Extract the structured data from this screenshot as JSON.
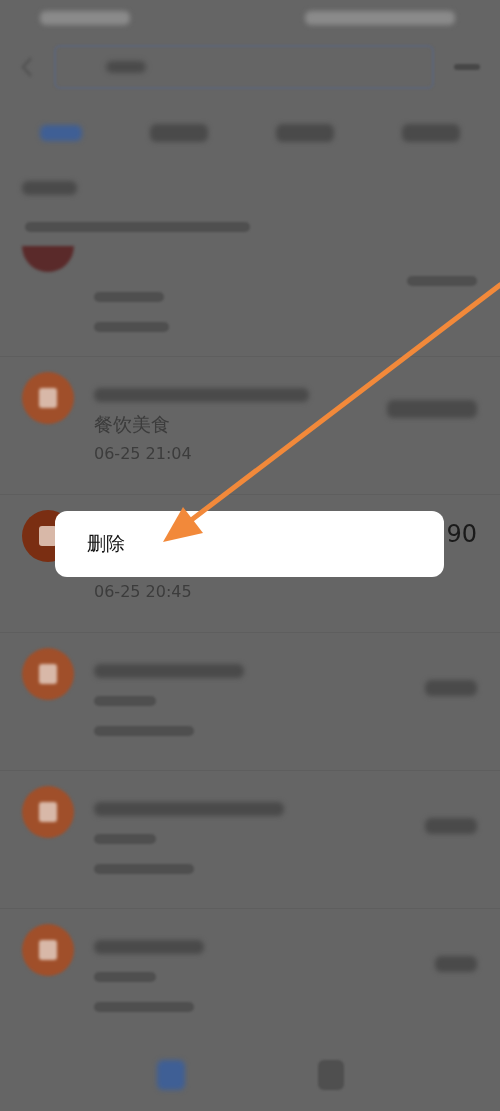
{
  "transactions": [
    {
      "category": "餐饮美食",
      "time": "06-25 21:04"
    },
    {
      "amount": "90",
      "time": "06-25 20:45"
    }
  ],
  "context_menu": {
    "items": [
      "删除"
    ]
  },
  "tabs": [
    {
      "selected": true
    },
    {
      "selected": false
    },
    {
      "selected": false
    },
    {
      "selected": false
    }
  ]
}
